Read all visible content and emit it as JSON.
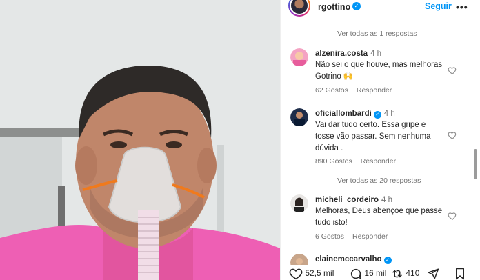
{
  "post": {
    "username": "rgottino",
    "follow_label": "Seguir",
    "more_label": "•••"
  },
  "comments": [
    {
      "type": "view_replies",
      "label": "Ver todas as 1 respostas"
    },
    {
      "user": "alzenira.costa",
      "time": "4 h",
      "verified": false,
      "text": "Não sei o que houve, mas melhoras Gotrino 🙌",
      "likes": "62 Gostos",
      "reply_label": "Responder"
    },
    {
      "user": "oficiallombardi",
      "time": "4 h",
      "verified": true,
      "text": "Vai dar tudo certo. Essa gripe e tosse vão passar. Sem nenhuma dúvida .",
      "likes": "890 Gostos",
      "reply_label": "Responder"
    },
    {
      "type": "view_replies",
      "label": "Ver todas as 20 respostas"
    },
    {
      "user": "micheli_cordeiro",
      "time": "4 h",
      "verified": false,
      "text": "Melhoras, Deus abençoe que passe tudo isto!",
      "likes": "6 Gostos",
      "reply_label": "Responder"
    },
    {
      "user": "elainemccarvalho",
      "time": "",
      "verified": true,
      "text": "",
      "likes": "",
      "reply_label": ""
    }
  ],
  "actions": {
    "likes_count": "52,5 mil",
    "comments_count": "16 mil",
    "shares_count": "410"
  },
  "colors": {
    "accent": "#0095f6",
    "shirt": "#ee5fb4",
    "mask_strap": "#f07a1c"
  }
}
